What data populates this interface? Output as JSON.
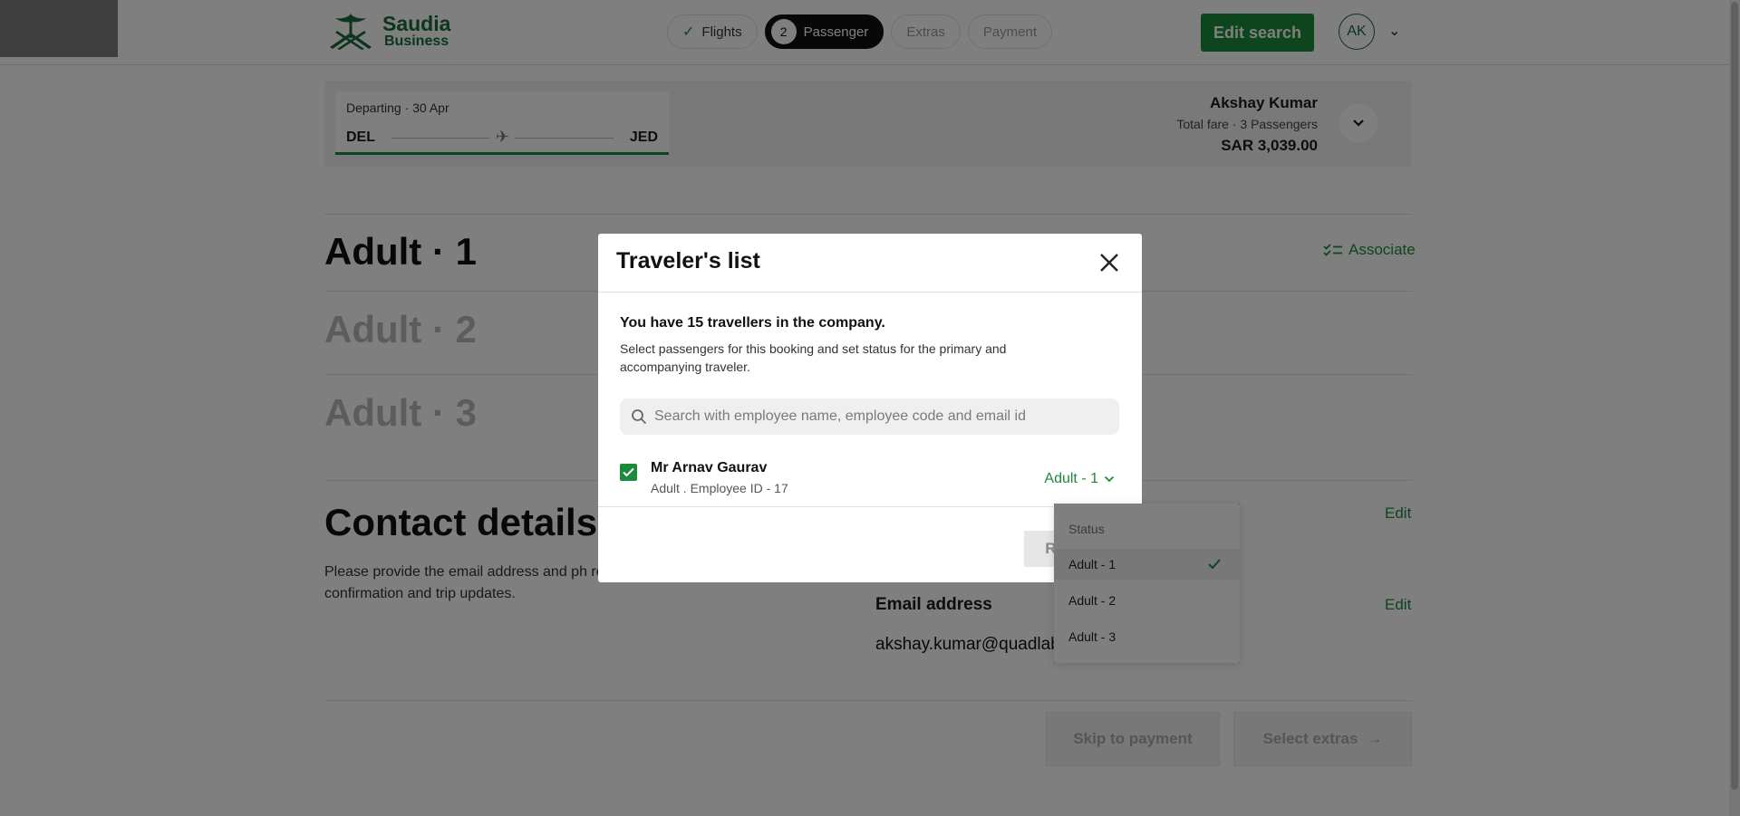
{
  "header": {
    "logo_line1": "Saudia",
    "logo_line2": "Business",
    "steps": [
      {
        "label": "Flights",
        "state": "done"
      },
      {
        "number": "2",
        "label": "Passenger",
        "state": "active"
      },
      {
        "label": "Extras",
        "state": "pending"
      },
      {
        "label": "Payment",
        "state": "pending"
      }
    ],
    "edit_search_label": "Edit search",
    "avatar_initials": "AK"
  },
  "summary": {
    "departing": "Departing · 30 Apr",
    "from": "DEL",
    "to": "JED",
    "traveller_name": "Akshay Kumar",
    "total_fare_label": "Total fare · 3 Passengers",
    "amount": "SAR 3,039.00"
  },
  "passengers": {
    "adult1": "Adult · 1",
    "adult2": "Adult · 2",
    "adult3": "Adult · 3",
    "associate_label": "Associate"
  },
  "contact": {
    "heading": "Contact details",
    "description": "Please provide the email address and ph receive your booking confirmation and trip updates.",
    "edit_label": "Edit",
    "email_label": "Email address",
    "email_value": "akshay.kumar@quadlabs.com"
  },
  "footer": {
    "skip_label": "Skip to payment",
    "extras_label": "Select extras"
  },
  "modal": {
    "title": "Traveler's list",
    "info": "You have 15 travellers in the company.",
    "description": "Select passengers for this booking and set status for the primary and accompanying traveler.",
    "search_placeholder": "Search with employee name, employee code and email id",
    "traveller": {
      "name": "Mr Arnav Gaurav",
      "meta": "Adult . Employee ID - 17",
      "status": "Adult - 1",
      "checked": true
    },
    "review_label": "Review"
  },
  "dropdown": {
    "heading": "Status",
    "options": [
      "Adult - 1",
      "Adult - 2",
      "Adult - 3"
    ],
    "selected": "Adult - 1"
  },
  "colors": {
    "brand_green": "#1b8a3a",
    "logo_green": "#1b6b3a",
    "overlay": "rgba(0,0,0,0.5)"
  }
}
